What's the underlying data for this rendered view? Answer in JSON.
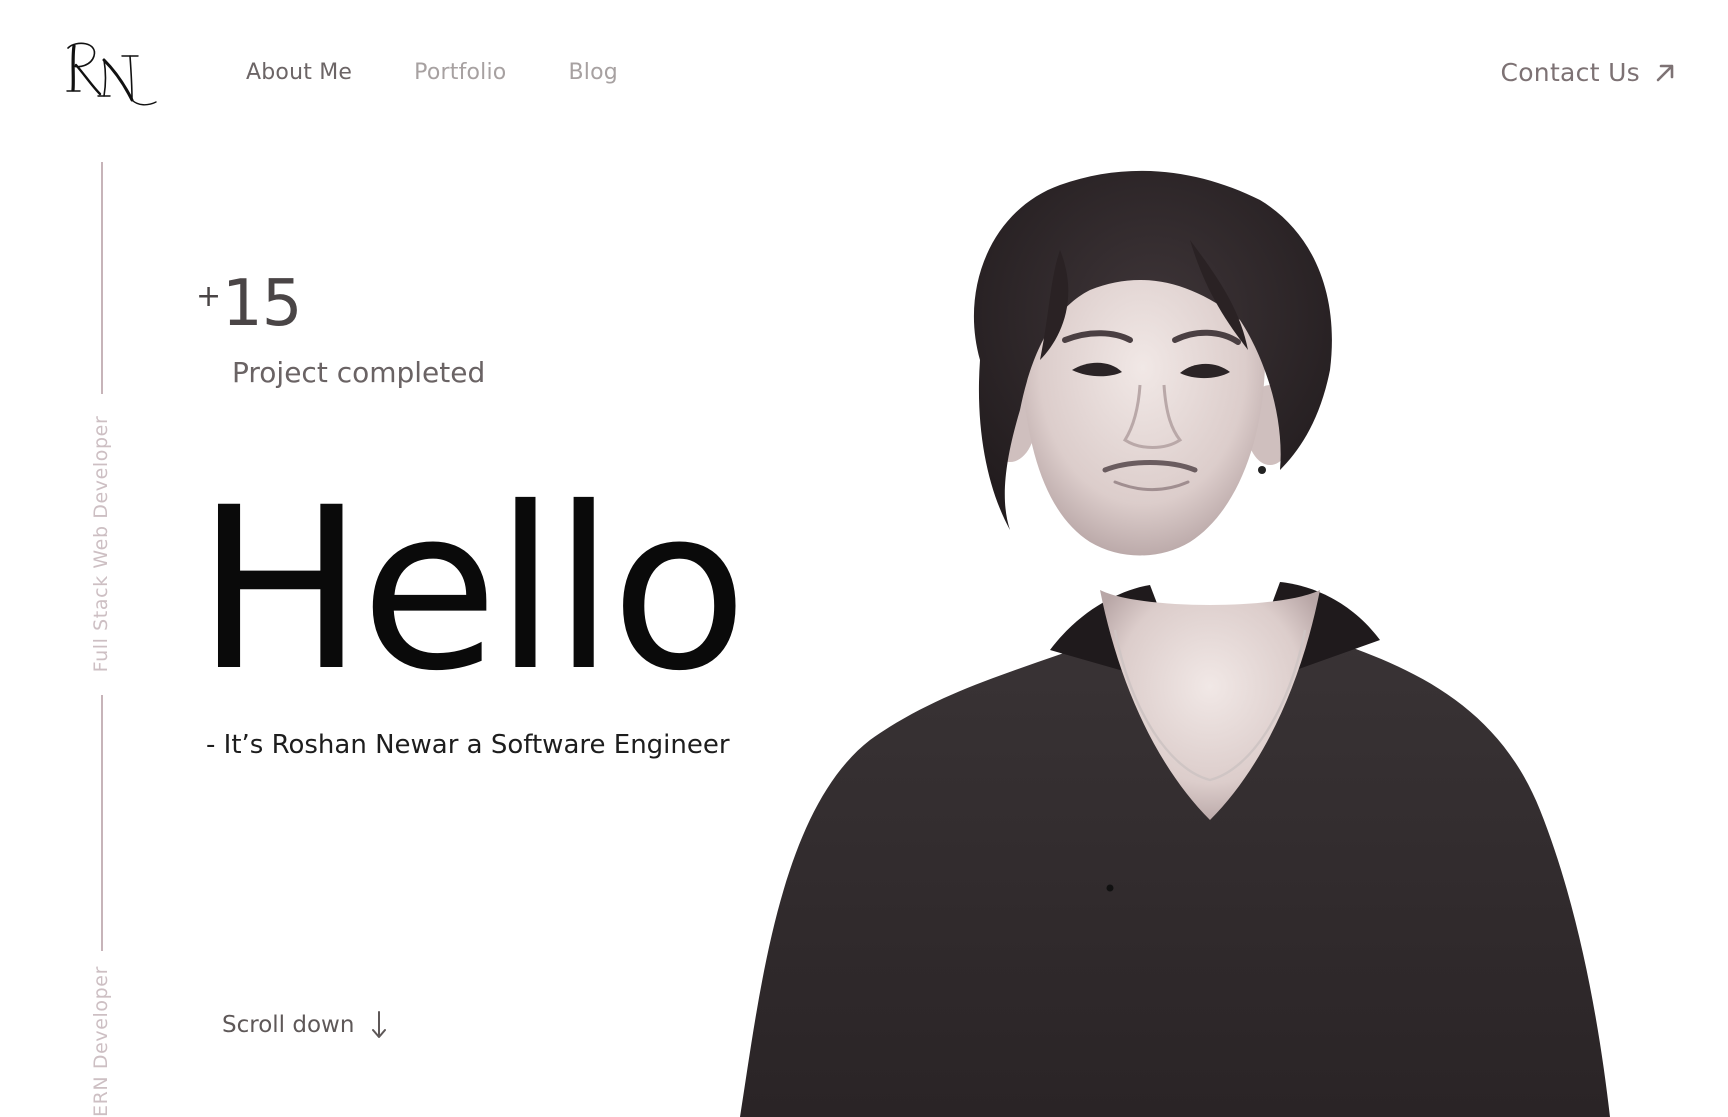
{
  "header": {
    "logo_text": "RN",
    "nav": [
      {
        "label": "About Me"
      },
      {
        "label": "Portfolio"
      },
      {
        "label": "Blog"
      }
    ],
    "contact_label": "Contact Us",
    "contact_icon": "arrow-up-right-icon"
  },
  "rail": {
    "role_1": "Full Stack  Web Developer",
    "role_2": "MERN Developer"
  },
  "stats": {
    "prefix": "+",
    "count": "15",
    "label": "Project completed"
  },
  "hero": {
    "greeting": "Hello",
    "tagline": "- It’s Roshan Newar a Software Engineer"
  },
  "scroll": {
    "label": "Scroll down",
    "icon": "arrow-down-icon"
  },
  "portrait": {
    "icon": "portrait-photo"
  },
  "colors": {
    "rail_line": "#c7b4b9",
    "rail_text": "#cdbfc3",
    "nav_active": "#6c6566",
    "nav_inactive": "#a7a1a1",
    "contact": "#7d7274",
    "heading": "#0a0a0a"
  }
}
